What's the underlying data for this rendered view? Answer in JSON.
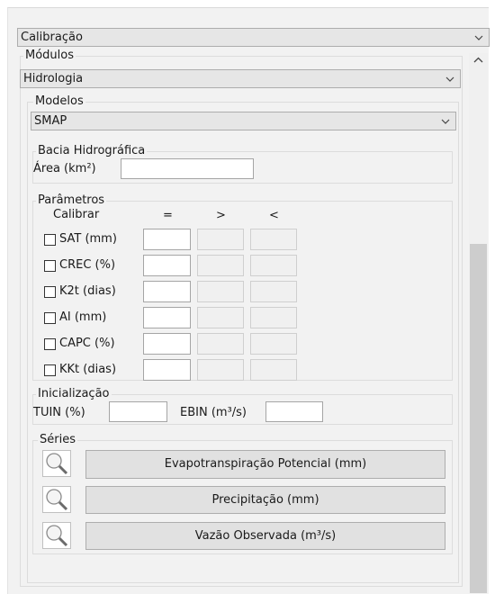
{
  "calibracao": {
    "selected": "Calibração"
  },
  "modulos": {
    "title": "Módulos",
    "selected": "Hidrologia"
  },
  "modelos": {
    "title": "Modelos",
    "selected": "SMAP"
  },
  "bacia": {
    "title": "Bacia Hidrográfica",
    "area_label": "Área (km²)",
    "area_value": ""
  },
  "parametros": {
    "title": "Parâmetros",
    "headers": {
      "calibrar": "Calibrar",
      "eq": "=",
      "gt": ">",
      "lt": "<"
    },
    "rows": [
      {
        "label": "SAT (mm)",
        "checked": false
      },
      {
        "label": "CREC (%)",
        "checked": false
      },
      {
        "label": "K2t (dias)",
        "checked": false
      },
      {
        "label": "AI (mm)",
        "checked": false
      },
      {
        "label": "CAPC (%)",
        "checked": false
      },
      {
        "label": "KKt (dias)",
        "checked": false
      }
    ]
  },
  "inicializacao": {
    "title": "Inicialização",
    "tuin_label": "TUIN (%)",
    "ebin_label": "EBIN (m³/s)"
  },
  "series": {
    "title": "Séries",
    "buttons": [
      {
        "label": "Evapotranspiração Potencial (mm)",
        "icon": "magnifier-icon"
      },
      {
        "label": "Precipitação (mm)",
        "icon": "magnifier-icon"
      },
      {
        "label": "Vazão Observada (m³/s)",
        "icon": "magnifier-icon"
      }
    ]
  },
  "colors": {
    "panel_bg": "#f2f2f2",
    "button_bg": "#e1e1e1",
    "scroll_thumb": "#cdcdcd"
  }
}
